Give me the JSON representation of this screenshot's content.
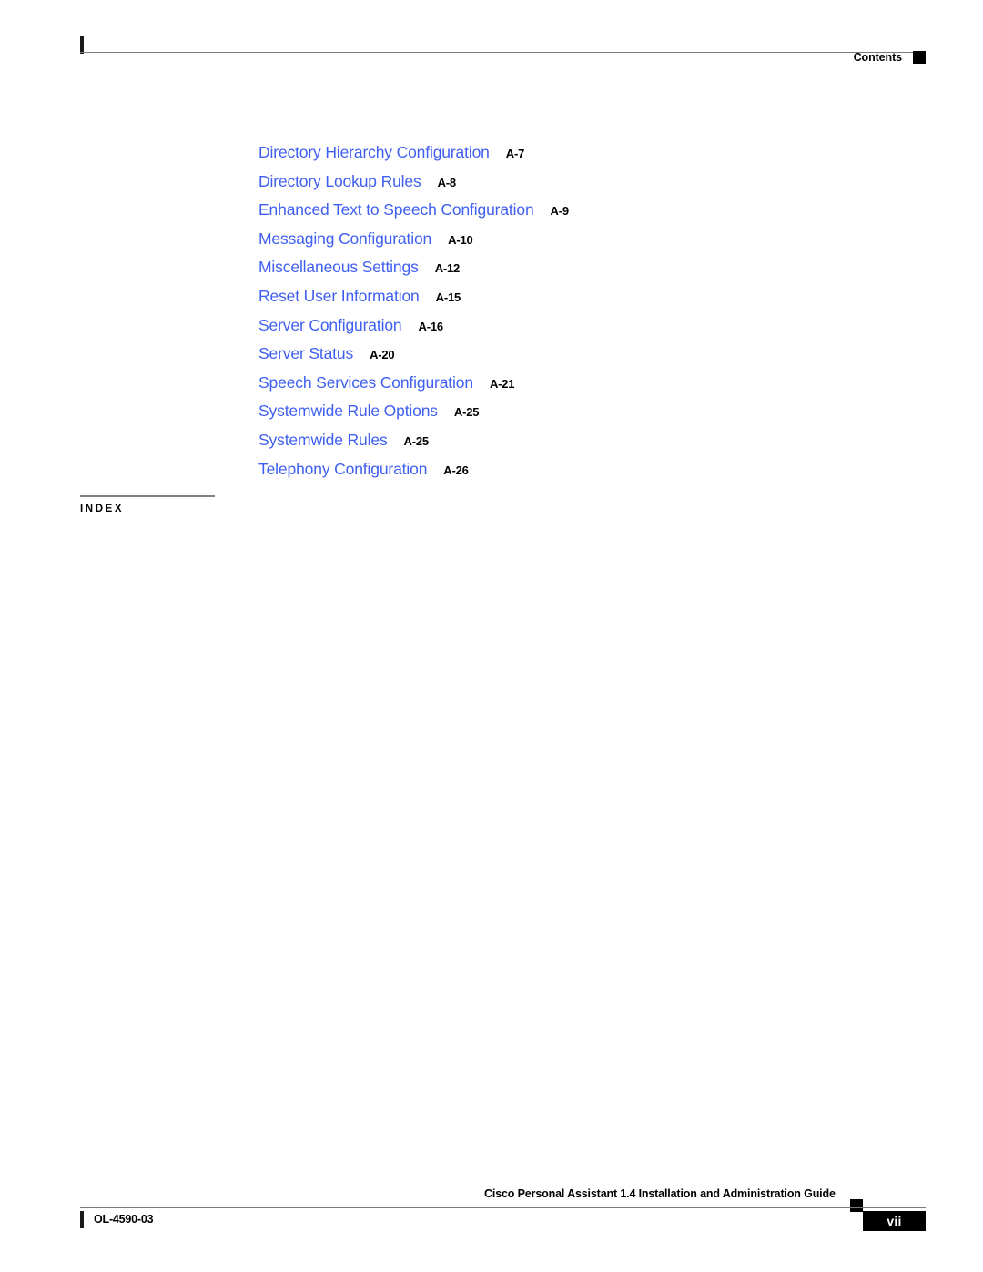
{
  "header": {
    "label": "Contents",
    "marker_icon": "black-square-marker"
  },
  "toc": {
    "entries": [
      {
        "title": "Directory Hierarchy Configuration",
        "page": "A-7"
      },
      {
        "title": "Directory Lookup Rules",
        "page": "A-8"
      },
      {
        "title": "Enhanced Text to Speech Configuration",
        "page": "A-9"
      },
      {
        "title": "Messaging Configuration",
        "page": "A-10"
      },
      {
        "title": "Miscellaneous Settings",
        "page": "A-12"
      },
      {
        "title": "Reset User Information",
        "page": "A-15"
      },
      {
        "title": "Server Configuration",
        "page": "A-16"
      },
      {
        "title": "Server Status",
        "page": "A-20"
      },
      {
        "title": "Speech Services Configuration",
        "page": "A-21"
      },
      {
        "title": "Systemwide Rule Options",
        "page": "A-25"
      },
      {
        "title": "Systemwide Rules",
        "page": "A-25"
      },
      {
        "title": "Telephony Configuration",
        "page": "A-26"
      }
    ]
  },
  "index_section": {
    "label": "INDEX"
  },
  "footer": {
    "guide_title": "Cisco Personal Assistant 1.4 Installation and Administration Guide",
    "marker_icon": "black-square-marker",
    "doc_id": "OL-4590-03",
    "page_number": "vii"
  },
  "colors": {
    "link_blue": "#3f5ff0",
    "rule_gray": "#7a7a7a",
    "index_rule_gray": "#808080",
    "text_black": "#000000"
  }
}
